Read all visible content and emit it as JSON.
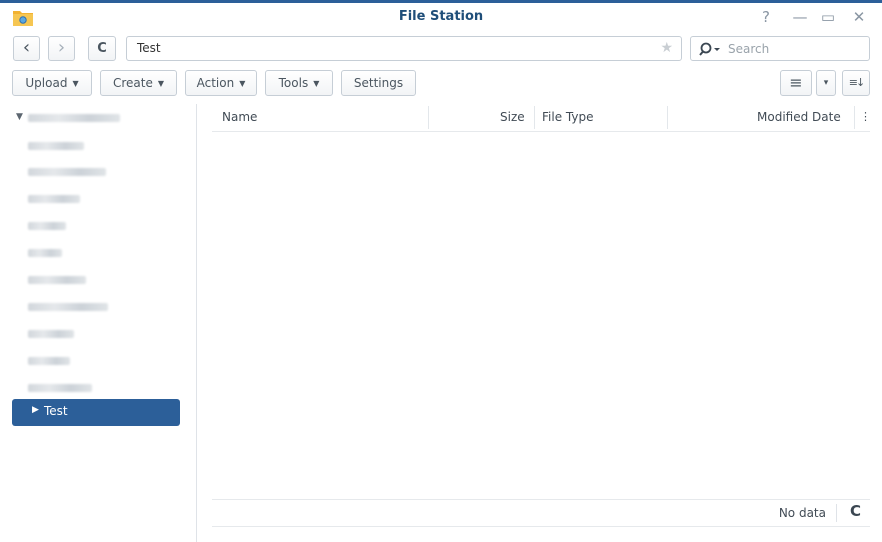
{
  "window": {
    "title": "File Station",
    "controls": {
      "help": "?",
      "minimize": "—",
      "maximize": "▭",
      "close": "✕"
    }
  },
  "nav": {
    "back_icon": "‹",
    "forward_icon": "›",
    "refresh_icon": "C",
    "path": "Test",
    "favorite_icon": "★",
    "search_placeholder": "Search"
  },
  "toolbar": {
    "upload": "Upload",
    "create": "Create",
    "action": "Action",
    "tools": "Tools",
    "settings": "Settings",
    "view_list_icon": "≡",
    "view_dropdown_icon": "▾",
    "sort_icon": "≡↓"
  },
  "sidebar": {
    "root_arrow": "▼",
    "selected": {
      "arrow": "▶",
      "label": "Test"
    }
  },
  "grid": {
    "columns": [
      "Name",
      "Size",
      "File Type",
      "Modified Date"
    ],
    "more_icon": "⋮"
  },
  "status": {
    "text": "No data",
    "refresh_icon": "C"
  },
  "colors": {
    "accent": "#2c5f99",
    "title": "#1f4e79",
    "border": "#c6ced6"
  }
}
